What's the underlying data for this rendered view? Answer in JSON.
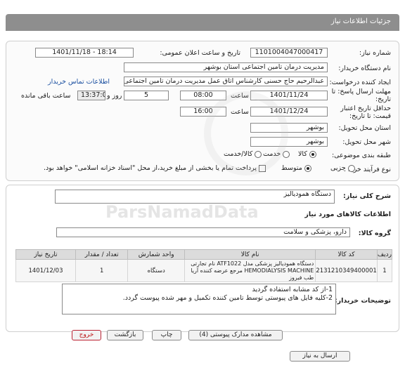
{
  "header": {
    "title": "جزئیات اطلاعات نیاز"
  },
  "form": {
    "need_number_label": "شماره نیاز:",
    "need_number": "1101004047000417",
    "announce_label": "تاریخ و ساعت اعلان عمومی:",
    "announce_value": "1401/11/18 - 18:14",
    "buyer_label": "نام دستگاه خریدار:",
    "buyer_value": "مدیریت درمان تامین اجتماعی استان بوشهر",
    "creator_label": "ایجاد کننده درخواست:",
    "creator_value": "عبدالرحیم حاج حسنی کارشناس اتاق عمل مدیریت درمان تامین اجتماعی استا",
    "contact_link": "اطلاعات تماس خریدار",
    "deadline_label": "مهلت ارسال پاسخ: تا تاریخ:",
    "deadline_date": "1401/11/24",
    "time_label": "ساعت",
    "deadline_time": "08:00",
    "days_count": "5",
    "days_label": "روز و",
    "remain_time": "13:37:06",
    "remain_label": "ساعت باقی مانده",
    "validity_label": "حداقل تاریخ اعتبار قیمت: تا تاریخ:",
    "validity_date": "1401/12/24",
    "validity_time": "16:00",
    "province_label": "استان محل تحویل:",
    "province_value": "بوشهر",
    "city_label": "شهر محل تحویل:",
    "city_value": "بوشهر",
    "category_label": "طبقه بندی موضوعی:",
    "cat_goods": "کالا",
    "cat_service": "خدمت",
    "cat_goods_service": "کالا/خدمت",
    "process_label": "نوع فرآیند خرید :",
    "proc_minor": "جزیی",
    "proc_medium": "متوسط",
    "payment_note": "پرداخت تمام یا بخشی از مبلغ خرید،از محل \"اسناد خزانه اسلامی\" خواهد بود."
  },
  "details": {
    "summary_label": "شرح کلی نیاز:",
    "summary_value": "دستگاه همودیالیز",
    "goods_info_title": "اطلاعات کالاهای مورد نیاز",
    "group_label": "گروه کالا:",
    "group_value": "دارو، پزشکی و سلامت",
    "table": {
      "headers": [
        "ردیف",
        "کد کالا",
        "نام کالا",
        "واحد شمارش",
        "تعداد / مقدار",
        "تاریخ نیاز"
      ],
      "rows": [
        {
          "row": "1",
          "code": "2131210349400001",
          "name": "دستگاه همودیالیز پزشکی مدل ATF1022 نام تجارتی HEMODIALYSIS MACHINE مرجع عرضه کننده آریا طب فیروز",
          "unit": "دستگاه",
          "qty": "1",
          "date": "1401/12/03"
        }
      ]
    },
    "buyer_notes_label": "توضیحات خریدار:",
    "buyer_notes_line1": "1-از کد مشابه استفاده گردید",
    "buyer_notes_line2": "2-کلیه فایل های پیوستی توسط تامین کننده تکمیل و مهر شده پیوست گردد."
  },
  "buttons": {
    "send_reply": "ارسال به نیاز",
    "view_docs": "مشاهده مدارک پیوستی (4)",
    "print": "چاپ",
    "back": "بازگشت",
    "exit": "خروج"
  },
  "watermark": {
    "brand": "ParsNamadData"
  },
  "colors": {
    "title_bar": "#8e8e8e",
    "link": "#1a4fa0",
    "exit_button": "#bb1111"
  }
}
